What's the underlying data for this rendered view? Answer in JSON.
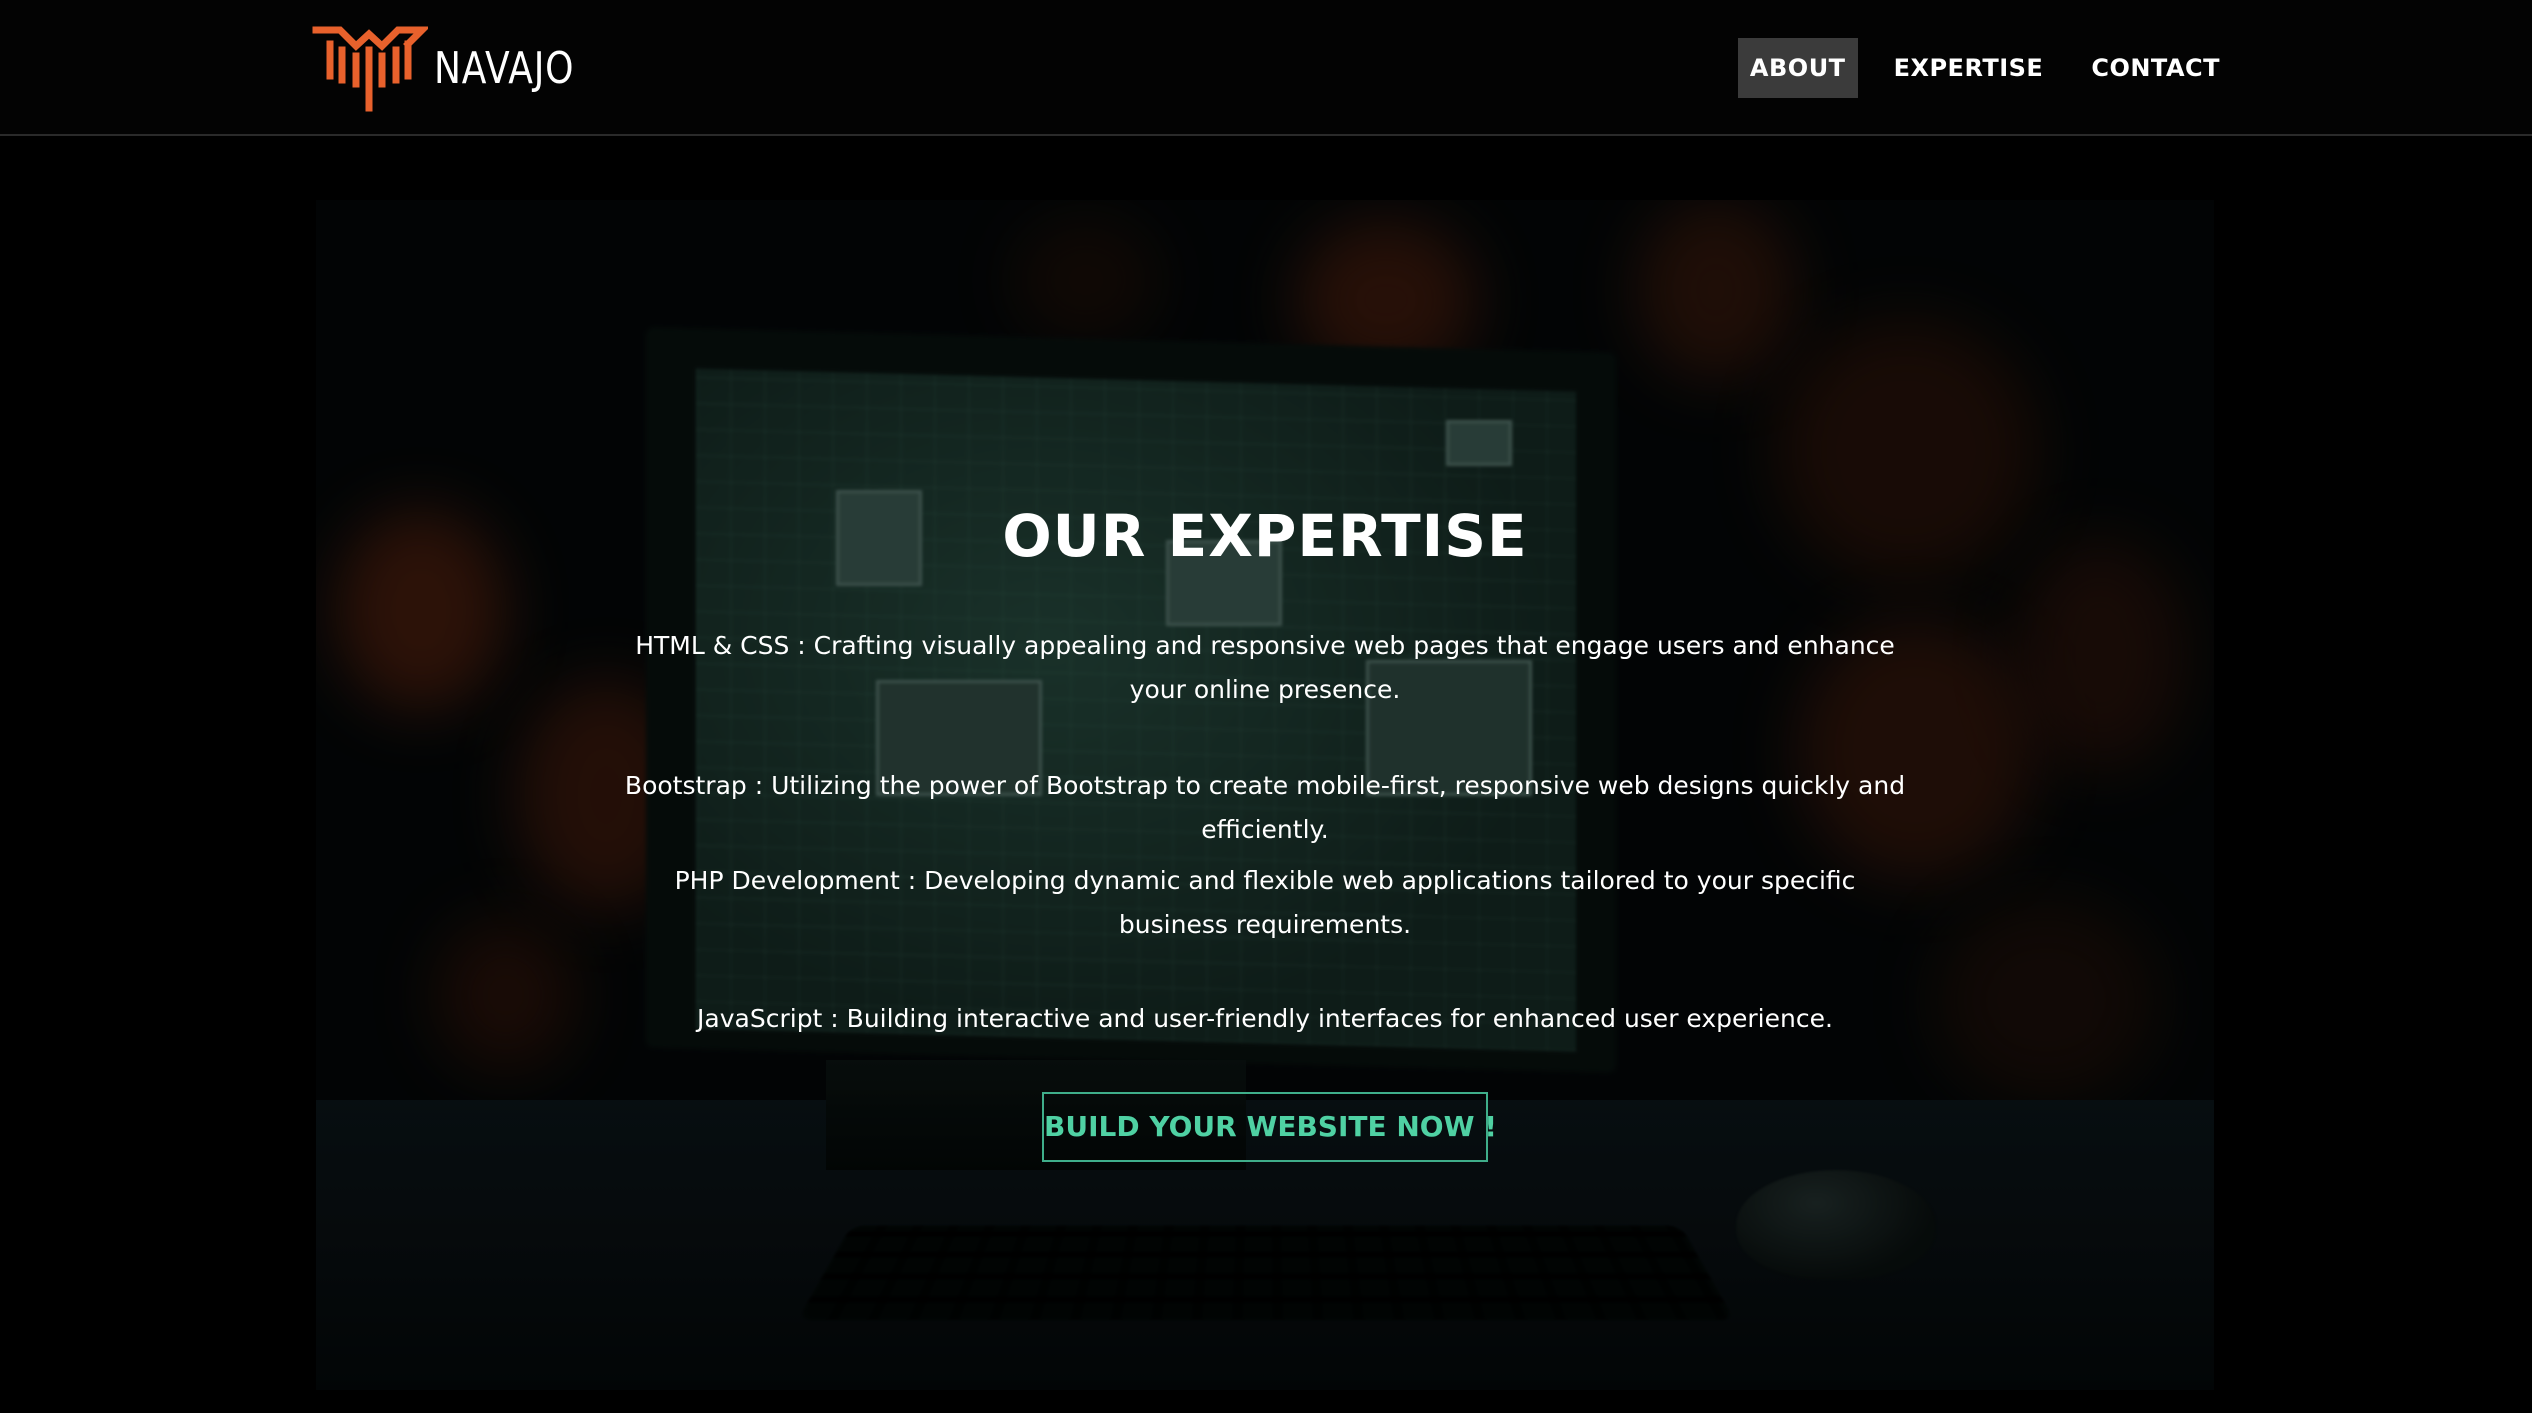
{
  "brand": {
    "name": "NAVAJO",
    "logo_color": "#E8612C"
  },
  "nav": {
    "items": [
      {
        "label": "ABOUT",
        "active": true
      },
      {
        "label": "EXPERTISE",
        "active": false
      },
      {
        "label": "CONTACT",
        "active": false
      }
    ]
  },
  "hero": {
    "title": "OUR EXPERTISE",
    "items": [
      "HTML & CSS : Crafting visually appealing and responsive web pages that engage users and enhance your online presence.",
      "Bootstrap : Utilizing the power of Bootstrap to create mobile-first, responsive web designs quickly and efficiently.",
      "PHP Development : Developing dynamic and flexible web applications tailored to your specific business requirements.",
      "JavaScript : Building interactive and user-friendly interfaces for enhanced user experience."
    ],
    "cta_label": "BUILD YOUR WEBSITE NOW !",
    "accent_color": "#4FD1A3"
  }
}
